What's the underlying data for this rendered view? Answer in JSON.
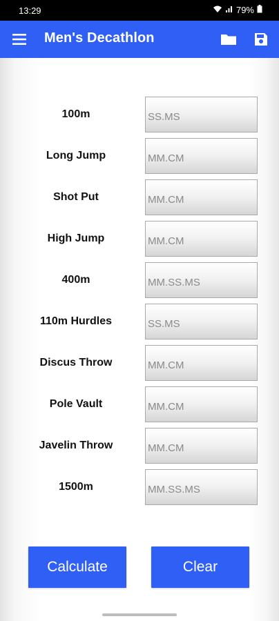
{
  "status_bar": {
    "time": "13:29",
    "battery": "79%"
  },
  "app_bar": {
    "title": "Men's Decathlon",
    "menu_icon": "hamburger-menu-icon",
    "folder_icon": "folder-icon",
    "save_icon": "save-icon"
  },
  "events": [
    {
      "label": "100m",
      "placeholder": "SS.MS"
    },
    {
      "label": "Long Jump",
      "placeholder": "MM.CM"
    },
    {
      "label": "Shot Put",
      "placeholder": "MM.CM"
    },
    {
      "label": "High Jump",
      "placeholder": "MM.CM"
    },
    {
      "label": "400m",
      "placeholder": "MM.SS.MS"
    },
    {
      "label": "110m Hurdles",
      "placeholder": "SS.MS"
    },
    {
      "label": "Discus Throw",
      "placeholder": "MM.CM"
    },
    {
      "label": "Pole Vault",
      "placeholder": "MM.CM"
    },
    {
      "label": "Javelin Throw",
      "placeholder": "MM.CM"
    },
    {
      "label": "1500m",
      "placeholder": "MM.SS.MS"
    }
  ],
  "buttons": {
    "calculate": "Calculate",
    "clear": "Clear"
  },
  "colors": {
    "accent": "#2f5ff5"
  }
}
